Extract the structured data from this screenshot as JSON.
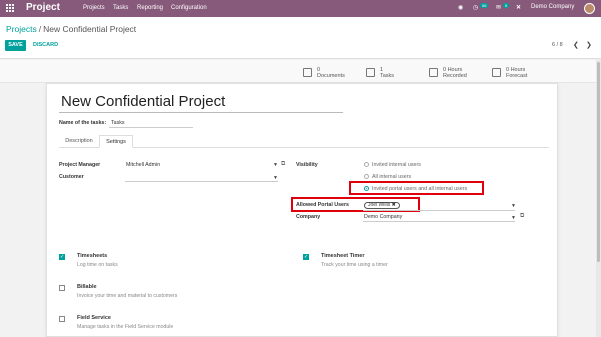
{
  "navbar": {
    "app_name": "Project",
    "menu": [
      "Projects",
      "Tasks",
      "Reporting",
      "Configuration"
    ],
    "messages_count": "5",
    "activities_count": "56",
    "company": "Demo Company"
  },
  "breadcrumb": {
    "parent": "Projects",
    "separator": "/",
    "current": "New Confidential Project"
  },
  "actions": {
    "save": "SAVE",
    "discard": "DISCARD"
  },
  "pager": {
    "value": "6 / 8"
  },
  "stat_buttons": [
    {
      "value": "0",
      "label": "Documents"
    },
    {
      "value": "1",
      "label": "Tasks"
    },
    {
      "value": "0 Hours",
      "label": "Recorded"
    },
    {
      "value": "0 Hours",
      "label": "Forecast"
    }
  ],
  "form": {
    "title": "New Confidential Project",
    "tasks_label": "Name of the tasks:",
    "tasks_value": "Tasks",
    "tabs": [
      "Description",
      "Settings"
    ],
    "project_manager_label": "Project Manager",
    "project_manager_value": "Mitchell Admin",
    "customer_label": "Customer",
    "visibility_label": "Visibility",
    "visibility_options": [
      "Invited internal users",
      "All internal users",
      "Invited portal users and all internal users"
    ],
    "visibility_selected": "Invited portal users and all internal users",
    "portal_users_label": "Allowed Portal Users",
    "portal_users_tag": "Joel Willis",
    "company_label": "Company",
    "company_value": "Demo Company"
  },
  "settings": [
    {
      "title": "Timesheets",
      "desc": "Log time on tasks",
      "checked": true
    },
    {
      "title": "Timesheet Timer",
      "desc": "Track your time using a timer",
      "checked": true
    },
    {
      "title": "Billable",
      "desc": "Invoice your time and material to customers",
      "checked": false
    },
    {
      "title": "Field Service",
      "desc": "Manage tasks in the Field Service module",
      "checked": false
    }
  ],
  "colors": {
    "brand": "#875a7b",
    "accent": "#00a09d",
    "highlight": "#e0000b"
  }
}
